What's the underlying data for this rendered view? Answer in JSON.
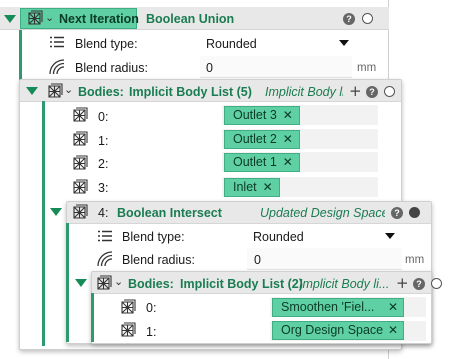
{
  "outer": {
    "iteration_button": "Next Iteration",
    "node_title": "Boolean Union",
    "blend_type_label": "Blend type:",
    "blend_type_value": "Rounded",
    "blend_radius_label": "Blend radius:",
    "blend_radius_value": "0",
    "unit": "mm"
  },
  "bodies1": {
    "label": "Bodies:",
    "list_title": "Implicit Body List (5)",
    "list_subtitle": "Implicit Body li...",
    "items": [
      {
        "index": "0:",
        "chip": "Outlet 3"
      },
      {
        "index": "1:",
        "chip": "Outlet 2"
      },
      {
        "index": "2:",
        "chip": "Outlet 1"
      },
      {
        "index": "3:",
        "chip": "Inlet"
      }
    ]
  },
  "intersect": {
    "index": "4:",
    "node_title": "Boolean Intersect",
    "subtitle": "Updated Design Space",
    "blend_type_label": "Blend type:",
    "blend_type_value": "Rounded",
    "blend_radius_label": "Blend radius:",
    "blend_radius_value": "0",
    "unit": "mm"
  },
  "bodies2": {
    "label": "Bodies:",
    "list_title": "Implicit Body List (2)",
    "list_subtitle": "Implicit Body li...",
    "items": [
      {
        "index": "0:",
        "chip": "Smoothen 'Fiel..."
      },
      {
        "index": "1:",
        "chip": "Org Design Space"
      }
    ]
  },
  "colors": {
    "accent": "#1a7c52",
    "chip": "#5fd0a4",
    "chip_border": "#3fae84"
  },
  "icons": [
    "lattice-icon",
    "list-icon",
    "radius-icon",
    "help-icon",
    "plus-icon",
    "circle-icon"
  ]
}
